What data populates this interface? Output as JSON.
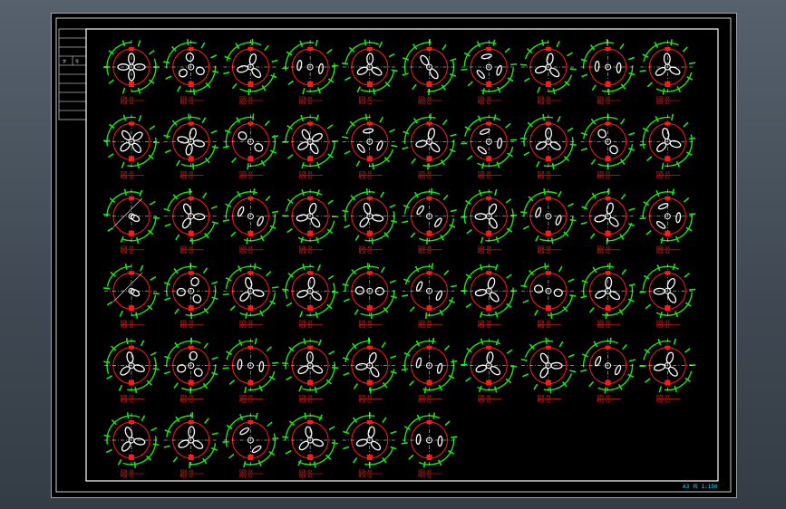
{
  "window": {
    "title": "",
    "background": "#4a5561"
  },
  "sheet": {
    "frame_color": "#ffffff",
    "scale_text": "A3 共 1:150",
    "scale_color": "#00e5ff"
  },
  "title_block": {
    "rows": 10,
    "header_glyphs": [
      "字",
      "号"
    ]
  },
  "colors": {
    "outer_ring": "#ff1a1a",
    "green_dim": "#19e619",
    "centerline": "#ffffff",
    "holes": "#ffffff",
    "label": "#ff2020"
  },
  "grid": {
    "columns": 10,
    "row_counts": [
      10,
      10,
      10,
      10,
      10,
      6
    ]
  },
  "parts": {
    "label_line_1": "DZ0-XX",
    "label_line_2": "M20 G2",
    "hole_patterns": [
      "petal-4",
      "ring-3",
      "petal-3",
      "slot-2",
      "petal-3",
      "petal-2",
      "slot-3",
      "petal-3",
      "slot-2",
      "petal-3",
      "petal-4",
      "petal-4",
      "ring-2",
      "petal-4",
      "slot-3",
      "petal-3",
      "slot-3",
      "petal-3",
      "ring-2",
      "petal-3",
      "cross",
      "petal-3",
      "slot-2",
      "petal-3",
      "petal-3",
      "slot-2",
      "petal-3",
      "slot-2",
      "petal-3",
      "slot-3",
      "cross",
      "ring-3",
      "petal-3",
      "petal-3",
      "ring-2",
      "slot-2",
      "petal-3",
      "ring-2",
      "petal-3",
      "petal-3",
      "petal-3",
      "ring-3",
      "slot-2",
      "petal-3",
      "petal-3",
      "slot-2",
      "petal-3",
      "petal-3",
      "slot-2",
      "petal-3",
      "petal-3",
      "petal-3",
      "slot-2",
      "petal-3",
      "petal-3",
      "slot-2"
    ]
  }
}
